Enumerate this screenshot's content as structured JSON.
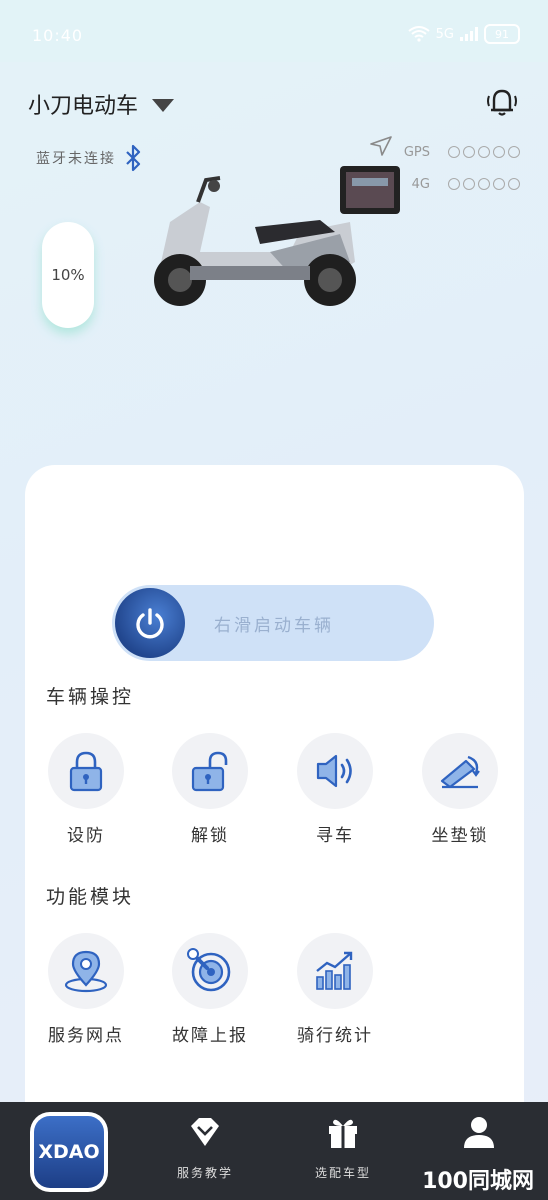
{
  "status_bar": {
    "time": "10:40",
    "network": "5G",
    "battery": "91"
  },
  "header": {
    "vehicle_name": "小刀电动车"
  },
  "bluetooth": {
    "status": "蓝牙未连接"
  },
  "signals": [
    {
      "label": "GPS",
      "level": 0,
      "max": 5
    },
    {
      "label": "4G",
      "level": 0,
      "max": 5
    }
  ],
  "battery": {
    "percent": "10%"
  },
  "slider": {
    "label": "右滑启动车辆"
  },
  "vehicle_control": {
    "title": "车辆操控",
    "items": [
      {
        "label": "设防",
        "icon": "lock-icon"
      },
      {
        "label": "解锁",
        "icon": "unlock-icon"
      },
      {
        "label": "寻车",
        "icon": "speaker-icon"
      },
      {
        "label": "坐垫锁",
        "icon": "seat-lock-icon"
      }
    ]
  },
  "functions": {
    "title": "功能模块",
    "items": [
      {
        "label": "服务网点",
        "icon": "location-pin-icon"
      },
      {
        "label": "故障上报",
        "icon": "wrench-target-icon"
      },
      {
        "label": "骑行统计",
        "icon": "bar-chart-icon"
      }
    ]
  },
  "tabbar": {
    "logo_text": "XDAO",
    "tabs": [
      {
        "label": "服务教学",
        "icon": "diamond-icon"
      },
      {
        "label": "选配车型",
        "icon": "gift-icon"
      },
      {
        "label": "",
        "icon": "user-icon"
      }
    ]
  },
  "watermark": "100同城网",
  "colors": {
    "accent": "#2f63c0",
    "slider_bg": "#cfe1f7",
    "tabbar_bg": "#2a2d33"
  }
}
